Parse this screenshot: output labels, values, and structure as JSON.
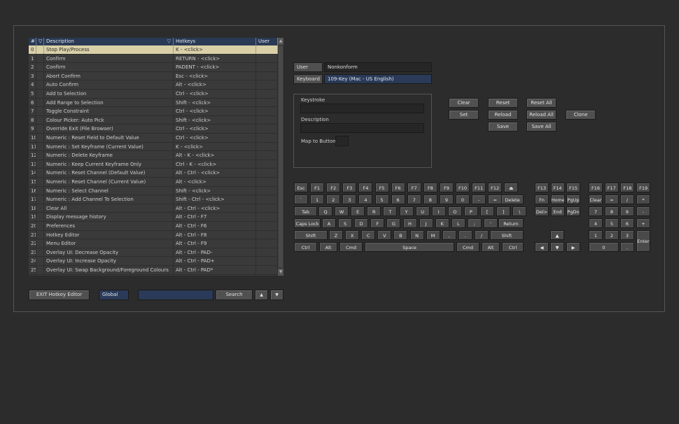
{
  "table": {
    "headers": {
      "num": "#",
      "filter_icon": "filter-icon",
      "description": "Description",
      "hotkeys": "Hotkeys",
      "user": "User"
    },
    "rows": [
      {
        "n": "0",
        "desc": "Stop Play/Process",
        "hotkey": "K - <click>"
      },
      {
        "n": "1",
        "desc": "Confirm",
        "hotkey": "RETURN - <click>"
      },
      {
        "n": "2",
        "desc": "Confirm",
        "hotkey": "PADENT - <click>"
      },
      {
        "n": "3",
        "desc": "Abort Confirm",
        "hotkey": "Esc - <click>"
      },
      {
        "n": "4",
        "desc": "Auto Confirm",
        "hotkey": "Alt - <click>"
      },
      {
        "n": "5",
        "desc": "Add to Selection",
        "hotkey": "Ctrl - <click>"
      },
      {
        "n": "6",
        "desc": "Add Range to Selection",
        "hotkey": "Shift - <click>"
      },
      {
        "n": "7",
        "desc": "Toggle Constraint",
        "hotkey": "Ctrl - <click>"
      },
      {
        "n": "8",
        "desc": "Colour Picker: Auto Pick",
        "hotkey": "Shift - <click>"
      },
      {
        "n": "9",
        "desc": "Override Exit (File Browser)",
        "hotkey": "Ctrl - <click>"
      },
      {
        "n": "10",
        "desc": "Numeric : Reset Field to Default Value",
        "hotkey": "Ctrl - <click>"
      },
      {
        "n": "11",
        "desc": "Numeric : Set Keyframe (Current Value)",
        "hotkey": "K - <click>"
      },
      {
        "n": "12",
        "desc": "Numeric : Delete Keyframe",
        "hotkey": "Alt - K - <click>"
      },
      {
        "n": "13",
        "desc": "Numeric : Keep Current Keyframe Only",
        "hotkey": "Ctrl - K - <click>"
      },
      {
        "n": "14",
        "desc": "Numeric : Reset Channel (Default Value)",
        "hotkey": "Alt - Ctrl - <click>"
      },
      {
        "n": "15",
        "desc": "Numeric : Reset Channel (Current Value)",
        "hotkey": "Alt - <click>"
      },
      {
        "n": "16",
        "desc": "Numeric : Select Channel",
        "hotkey": "Shift - <click>"
      },
      {
        "n": "17",
        "desc": "Numeric : Add Channel To Selection",
        "hotkey": "Shift - Ctrl - <click>"
      },
      {
        "n": "18",
        "desc": "Clear All",
        "hotkey": "Alt - Ctrl - <click>"
      },
      {
        "n": "19",
        "desc": "Display message history",
        "hotkey": "Alt - Ctrl - F7"
      },
      {
        "n": "20",
        "desc": "Preferences",
        "hotkey": "Alt - Ctrl - F6"
      },
      {
        "n": "21",
        "desc": "Hotkey Editor",
        "hotkey": "Alt - Ctrl - F8"
      },
      {
        "n": "22",
        "desc": "Menu Editor",
        "hotkey": "Alt - Ctrl - F9"
      },
      {
        "n": "23",
        "desc": "Overlay UI: Decrease Opacity",
        "hotkey": "Alt - Ctrl - PAD-"
      },
      {
        "n": "24",
        "desc": "Overlay UI: Increase Opacity",
        "hotkey": "Alt - Ctrl - PAD+"
      },
      {
        "n": "25",
        "desc": "Overlay UI: Swap Background/Foreground Colours",
        "hotkey": "Alt - Ctrl - PAD*"
      }
    ],
    "selected_row": 0
  },
  "bottom": {
    "exit_label": "EXIT Hotkey Editor",
    "scope_value": "Global",
    "search_value": "",
    "search_label": "Search",
    "up_icon": "arrow-up-icon",
    "down_icon": "arrow-down-icon"
  },
  "profile": {
    "user_label": "User",
    "user_value": "Nonkonform",
    "keyboard_label": "Keyboard",
    "keyboard_value": "109-Key (Mac - US English)"
  },
  "editor": {
    "keystroke_label": "Keystroke",
    "keystroke_value": "",
    "description_label": "Description",
    "description_value": "",
    "map_label": "Map to Button"
  },
  "actions": {
    "clear": "Clear",
    "set": "Set",
    "reset": "Reset",
    "reload": "Reload",
    "save": "Save",
    "reset_all": "Reset All",
    "reload_all": "Reload All",
    "save_all": "Save All",
    "clone": "Clone"
  },
  "keyboard": {
    "row1": [
      "Esc",
      "F1",
      "F2",
      "F3",
      "F4",
      "F5",
      "F6",
      "F7",
      "F8",
      "F9",
      "F10",
      "F11",
      "F12",
      "⏏"
    ],
    "row2": [
      "`",
      "1",
      "2",
      "3",
      "4",
      "5",
      "6",
      "7",
      "8",
      "9",
      "0",
      "-",
      "=",
      "Delete"
    ],
    "row3": [
      "Tab",
      "Q",
      "W",
      "E",
      "R",
      "T",
      "Y",
      "U",
      "I",
      "O",
      "P",
      "[",
      "]",
      "\\"
    ],
    "row4": [
      "Caps Lock",
      "A",
      "S",
      "D",
      "F",
      "G",
      "H",
      "J",
      "K",
      "L",
      ";",
      "'",
      "Return"
    ],
    "row5": [
      "Shift",
      "Z",
      "X",
      "C",
      "V",
      "B",
      "N",
      "M",
      ",",
      ".",
      "/",
      "Shift"
    ],
    "row6": [
      "Ctrl",
      "Alt",
      "Cmd",
      "Space",
      "Cmd",
      "Alt",
      "Ctrl"
    ],
    "fnrow": [
      "F13",
      "F14",
      "F15"
    ],
    "nav1": [
      "Fn",
      "Home",
      "PgUp"
    ],
    "nav2": [
      "Del>",
      "End",
      "PgDn"
    ],
    "arrows": [
      "▲",
      "◀",
      "▼",
      "▶"
    ],
    "pad_f": [
      "F16",
      "F17",
      "F18",
      "F19"
    ],
    "pad": [
      "Clear",
      "=",
      "/",
      "*",
      "7",
      "8",
      "9",
      "-",
      "4",
      "5",
      "6",
      "+",
      "1",
      "2",
      "3",
      "Enter",
      "0",
      "."
    ]
  }
}
